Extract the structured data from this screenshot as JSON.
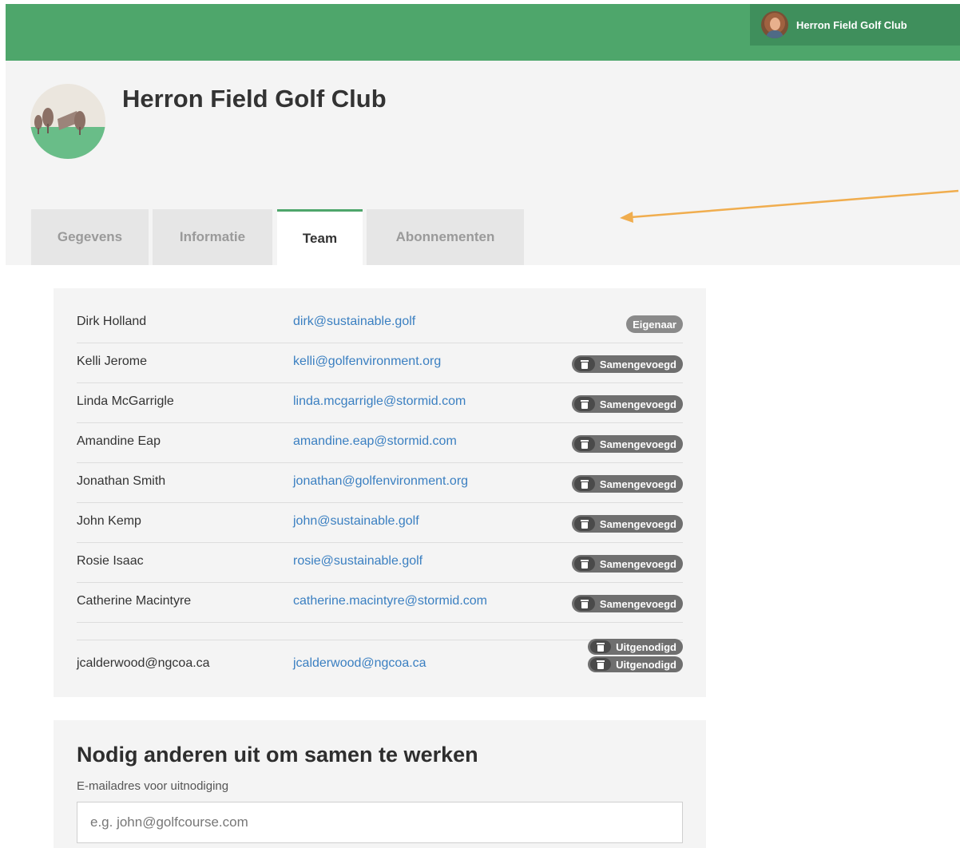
{
  "account": {
    "name": "Herron Field Golf Club"
  },
  "club": {
    "title": "Herron Field Golf Club"
  },
  "tabs": [
    {
      "label": "Gegevens",
      "active": false
    },
    {
      "label": "Informatie",
      "active": false
    },
    {
      "label": "Team",
      "active": true
    },
    {
      "label": "Abonnementen",
      "active": false
    }
  ],
  "team": {
    "members": [
      {
        "name": "Dirk Holland",
        "email": "dirk@sustainable.golf",
        "status": "Eigenaar"
      },
      {
        "name": "Kelli Jerome",
        "email": "kelli@golfenvironment.org",
        "status": "Samengevoegd"
      },
      {
        "name": "Linda McGarrigle",
        "email": "linda.mcgarrigle@stormid.com",
        "status": "Samengevoegd"
      },
      {
        "name": "Amandine Eap",
        "email": "amandine.eap@stormid.com",
        "status": "Samengevoegd"
      },
      {
        "name": "Jonathan Smith",
        "email": "jonathan@golfenvironment.org",
        "status": "Samengevoegd"
      },
      {
        "name": "John Kemp",
        "email": "john@sustainable.golf",
        "status": "Samengevoegd"
      },
      {
        "name": "Rosie Isaac",
        "email": "rosie@sustainable.golf",
        "status": "Samengevoegd"
      },
      {
        "name": "Catherine Macintyre",
        "email": "catherine.macintyre@stormid.com",
        "status": "Samengevoegd"
      }
    ],
    "invited": {
      "name": "jcalderwood@ngcoa.ca",
      "email": "jcalderwood@ngcoa.ca",
      "status_top": "Uitgenodigd",
      "status_bottom": "Uitgenodigd"
    }
  },
  "invite": {
    "title": "Nodig anderen uit om samen te werken",
    "label": "E-mailadres voor uitnodiging",
    "placeholder": "e.g. john@golfcourse.com"
  },
  "colors": {
    "brand_green": "#4ea66b",
    "link_blue": "#3a7fc1",
    "badge_gray": "#6f6f6f",
    "annotation_arrow": "#f0ad4e"
  },
  "icons": [
    "avatar",
    "club-logo",
    "trash-icon",
    "annotation-arrow"
  ]
}
